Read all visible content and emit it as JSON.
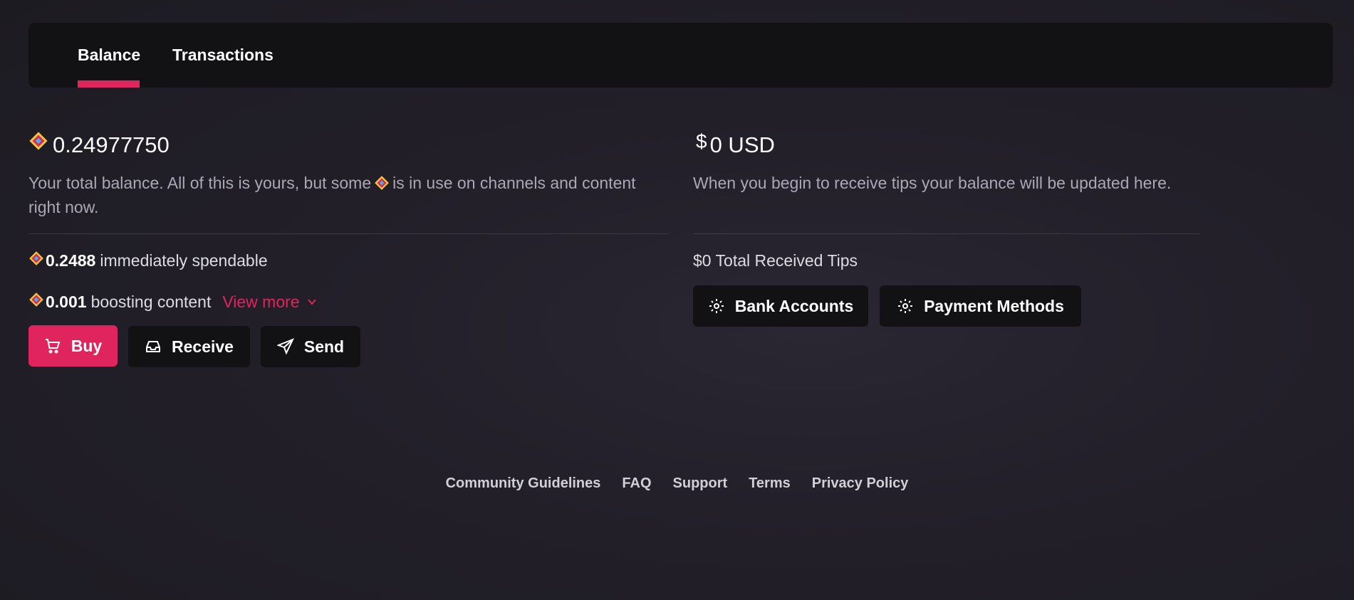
{
  "tabs": [
    {
      "label": "Balance",
      "active": true
    },
    {
      "label": "Transactions",
      "active": false
    }
  ],
  "lbc_balance": {
    "total": "0.24977750",
    "description_before": "Your total balance. All of this is yours, but some",
    "description_after": "is in use on channels and content right now.",
    "spendable_amount": "0.2488",
    "spendable_label": "immediately spendable",
    "boosting_amount": "0.001",
    "boosting_label": "boosting content",
    "view_more_label": "View more"
  },
  "actions": {
    "buy_label": "Buy",
    "receive_label": "Receive",
    "send_label": "Send"
  },
  "usd_balance": {
    "total": "0 USD",
    "description": "When you begin to receive tips your balance will be updated here.",
    "received_tips": "$0 Total Received Tips",
    "bank_accounts_label": "Bank Accounts",
    "payment_methods_label": "Payment Methods"
  },
  "footer": {
    "links": [
      "Community Guidelines",
      "FAQ",
      "Support",
      "Terms",
      "Privacy Policy"
    ]
  },
  "colors": {
    "accent": "#e0245e",
    "panel": "#121214",
    "background": "#221f29"
  }
}
